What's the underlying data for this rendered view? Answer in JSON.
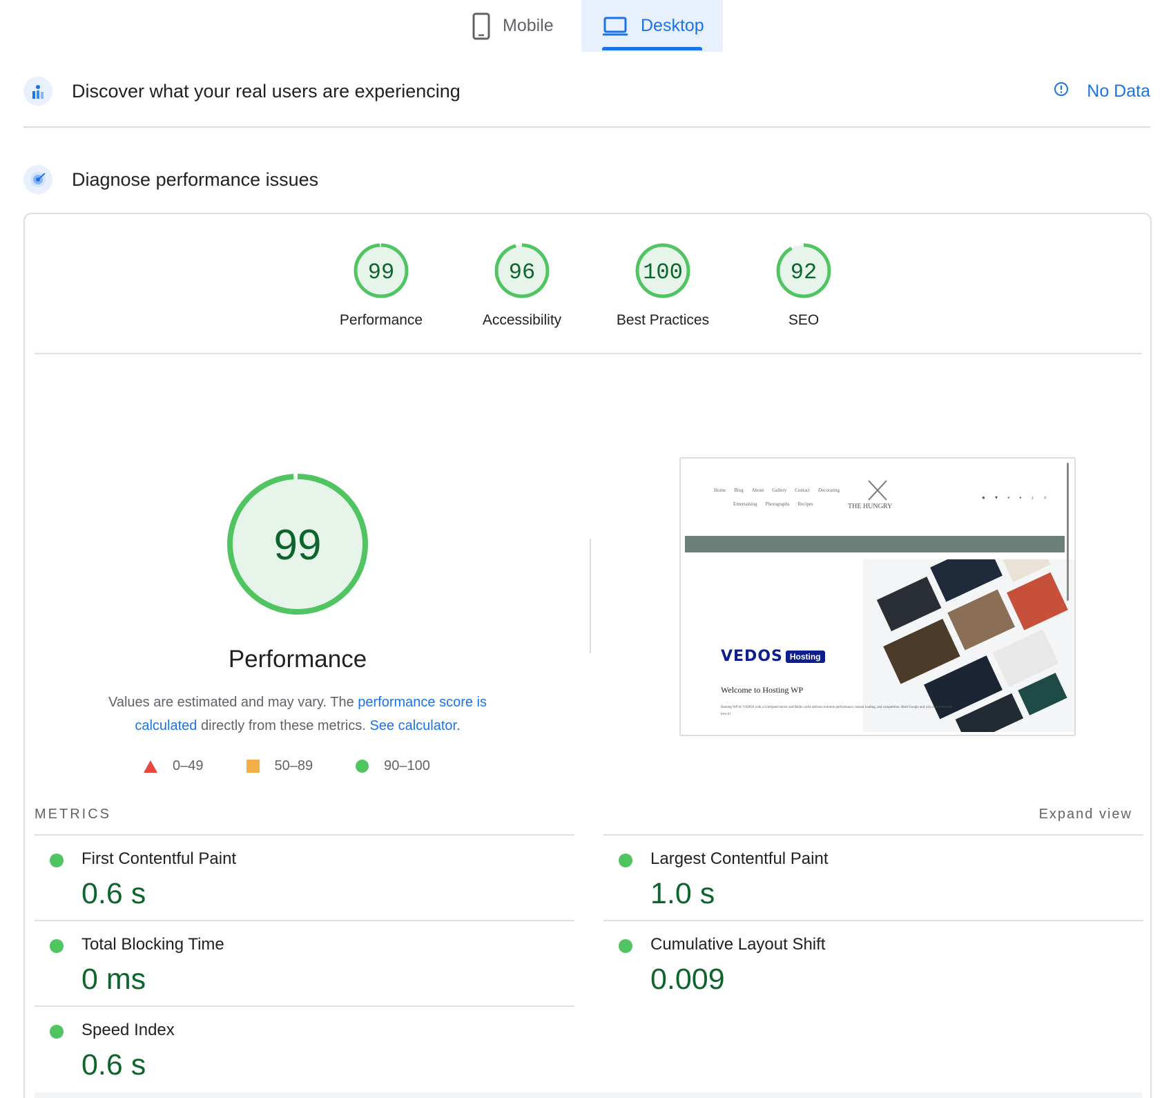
{
  "tabs": [
    {
      "label": "Mobile",
      "icon": "phone-icon",
      "active": false
    },
    {
      "label": "Desktop",
      "icon": "laptop-icon",
      "active": true
    }
  ],
  "crux": {
    "title": "Discover what your real users are experiencing",
    "icon": "users-chart-icon",
    "status": "No Data",
    "status_icon": "info-icon"
  },
  "diagnose": {
    "title": "Diagnose performance issues",
    "icon": "target-icon"
  },
  "categories": [
    {
      "label": "Performance",
      "score": "99",
      "fraction": 0.99
    },
    {
      "label": "Accessibility",
      "score": "96",
      "fraction": 0.96
    },
    {
      "label": "Best Practices",
      "score": "100",
      "fraction": 1.0
    },
    {
      "label": "SEO",
      "score": "92",
      "fraction": 0.92
    }
  ],
  "main_gauge": {
    "score": "99",
    "fraction": 0.99,
    "title": "Performance"
  },
  "note": {
    "text1": "Values are estimated and may vary. The ",
    "link1": "performance score is calculated",
    "text2": " directly from these metrics. ",
    "link2": "See calculator."
  },
  "legend": [
    {
      "shape": "triangle",
      "range": "0–49",
      "color": "#e8453c"
    },
    {
      "shape": "square",
      "range": "50–89",
      "color": "#f4b046"
    },
    {
      "shape": "circle",
      "range": "90–100",
      "color": "#4fc461"
    }
  ],
  "thumbnail": {
    "nav_row1": [
      "Home",
      "Blog",
      "About",
      "Gallery",
      "Contact",
      "Decorating"
    ],
    "nav_row2": [
      "Entertaining",
      "Photographs",
      "Recipes"
    ],
    "logo": "THE HUNGRY",
    "brand": "VEDOS",
    "brand_tag": "Hosting",
    "welcome": "Welcome to Hosting WP",
    "body": "Hosting WP by VEDOS with a LiteSpeed server and Redis cache delivers extreme performance, instant loading, and competition. Both Google and you customers will love it!"
  },
  "metrics": {
    "title": "METRICS",
    "expand_label": "Expand view",
    "items": [
      {
        "name": "First Contentful Paint",
        "value": "0.6 s"
      },
      {
        "name": "Largest Contentful Paint",
        "value": "1.0 s"
      },
      {
        "name": "Total Blocking Time",
        "value": "0 ms"
      },
      {
        "name": "Cumulative Layout Shift",
        "value": "0.009"
      },
      {
        "name": "Speed Index",
        "value": "0.6 s"
      }
    ]
  },
  "colors": {
    "accent": "#1a73e8",
    "pass": "#4fc461",
    "pass_text": "#0d652d",
    "gauge_fill": "#e6f4ea"
  }
}
